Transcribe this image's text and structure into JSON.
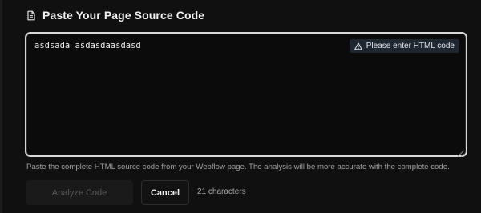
{
  "header": {
    "icon": "document-icon",
    "title": "Paste Your Page Source Code"
  },
  "editor": {
    "value": "asdsada asdasdaasdasd",
    "warning": {
      "icon": "warning-triangle-icon",
      "text": "Please enter HTML code"
    }
  },
  "help_text": "Paste the complete HTML source code from your Webflow page. The analysis will be more accurate with the complete code.",
  "actions": {
    "analyze_label": "Analyze Code",
    "cancel_label": "Cancel",
    "char_count": "21 characters"
  },
  "colors": {
    "background": "#101010",
    "editor_border": "#d9d9d9",
    "badge_bg": "#1e2630",
    "muted_text": "#a3a3a3"
  }
}
